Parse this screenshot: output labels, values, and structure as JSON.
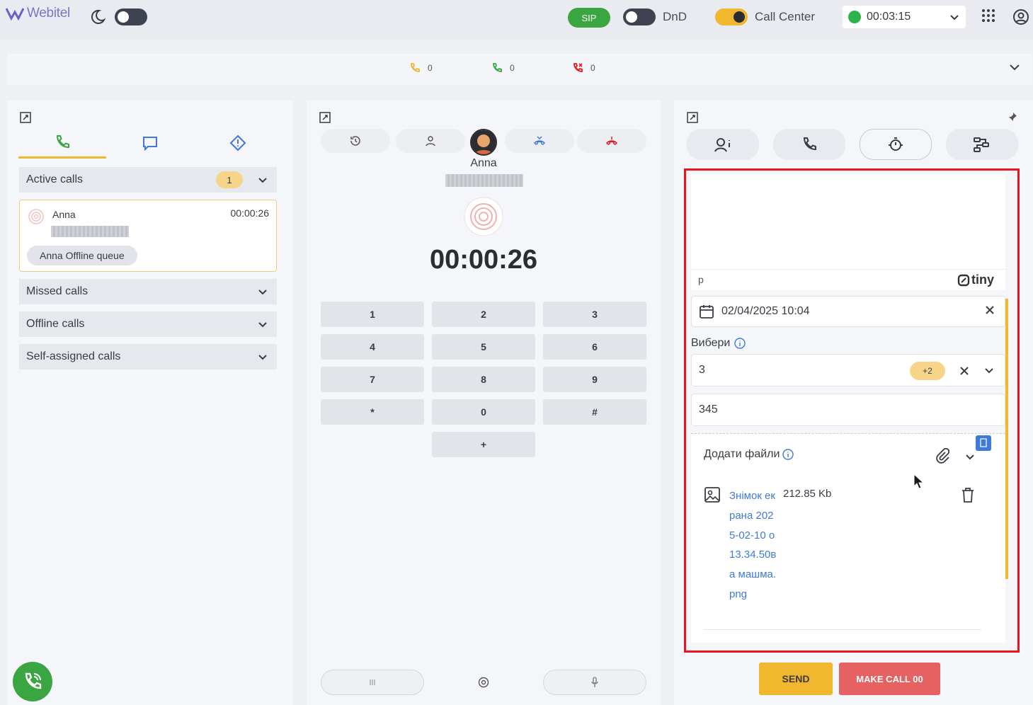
{
  "app": {
    "logo": "Webitel"
  },
  "topbar": {
    "sip_label": "SIP",
    "dnd_label": "DnD",
    "dnd_on": false,
    "callcenter_label": "Call Center",
    "callcenter_on": true,
    "status_time": "00:03:15",
    "status_color": "#2eb34a"
  },
  "counters": [
    {
      "icon": "incoming-call-icon",
      "value": "0",
      "color": "#f1b72e"
    },
    {
      "icon": "accepted-call-icon",
      "value": "0",
      "color": "#3aa641"
    },
    {
      "icon": "missed-call-icon",
      "value": "0",
      "color": "#e8161f"
    }
  ],
  "left": {
    "active_calls_label": "Active calls",
    "active_calls_count": "1",
    "call": {
      "name": "Anna",
      "number": "380930970782",
      "duration": "00:00:26",
      "queue": "Anna Offline queue"
    },
    "missed_calls_label": "Missed calls",
    "offline_calls_label": "Offline calls",
    "self_assigned_label": "Self-assigned calls"
  },
  "middle": {
    "caller_name": "Anna",
    "caller_number": "380930970782",
    "timer": "00:00:26",
    "keys": [
      "1",
      "2",
      "3",
      "4",
      "5",
      "6",
      "7",
      "8",
      "9",
      "*",
      "0",
      "#",
      "+"
    ]
  },
  "right": {
    "editor_path": "p",
    "editor_brand": "tiny",
    "date_value": "02/04/2025 10:04",
    "select_label": "Вибери",
    "select_value": "3",
    "select_more": "+2",
    "text_value": "345",
    "files_label": "Додати файли",
    "file": {
      "name": "Знімок екрана 2025-02-10 о 13.34.50ва машма.png",
      "size": "212.85 Kb"
    },
    "send_label": "SEND",
    "makecall_label": "MAKE CALL 00"
  },
  "colors": {
    "accent": "#f1b72e",
    "green": "#3aa641",
    "red": "#e8161f",
    "link": "#3f7ad6"
  }
}
